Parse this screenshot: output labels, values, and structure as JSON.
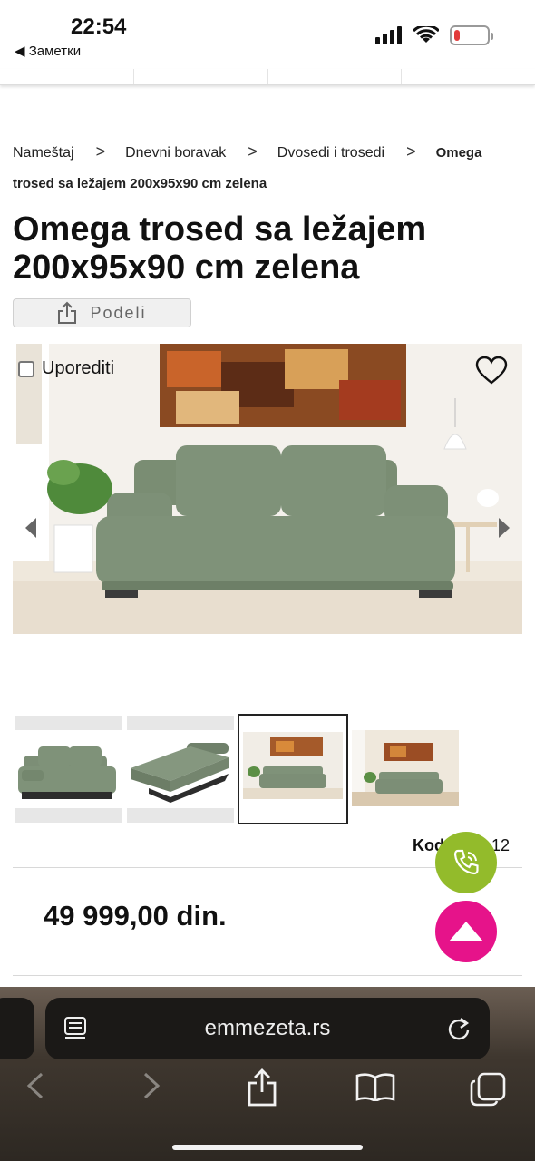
{
  "status": {
    "time": "22:54",
    "back_app": "◀ Заметки",
    "battery_level": 0.18,
    "battery_color": "#e23b3b"
  },
  "breadcrumb": {
    "items": [
      "Nameštaj",
      "Dnevni boravak",
      "Dvosedi i trosedi"
    ],
    "current": "Omega trosed sa ležajem 200x95x90 cm zelena",
    "separator": ">"
  },
  "product": {
    "title": "Omega trosed sa ležajem 200x95x90 cm zelena",
    "share_label": "Podeli",
    "compare_label": "Uporediti",
    "code_label": "Kod",
    "code_value": "12",
    "price": "49 999,00 din."
  },
  "icons": {
    "share": "share-icon",
    "favorite": "heart-icon",
    "prev": "chevron-left-icon",
    "next": "chevron-right-icon",
    "call": "phone-icon",
    "scroll_top": "up-arrow-icon"
  },
  "colors": {
    "call_button": "#93bb2b",
    "scroll_top_button": "#e6138a",
    "sofa": "#7f9279"
  },
  "browser": {
    "url": "emmezeta.rs"
  }
}
